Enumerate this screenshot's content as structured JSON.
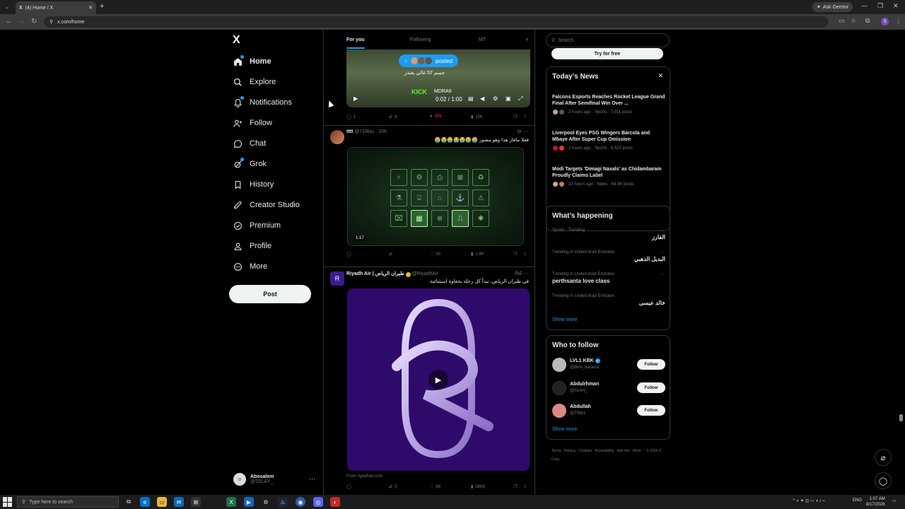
{
  "browser": {
    "tab_title": "(4) Home / X",
    "new_tab": "+",
    "ask_gemini": "Ask Gemini",
    "url": "x.com/home",
    "profile_initial": "S"
  },
  "nav": {
    "logo": "X",
    "items": [
      {
        "label": "Home"
      },
      {
        "label": "Explore"
      },
      {
        "label": "Notifications"
      },
      {
        "label": "Follow"
      },
      {
        "label": "Chat"
      },
      {
        "label": "Grok"
      },
      {
        "label": "History"
      },
      {
        "label": "Creator Studio"
      },
      {
        "label": "Premium"
      },
      {
        "label": "Profile"
      },
      {
        "label": "More"
      }
    ],
    "post_button": "Post",
    "account": {
      "name": "Abosalem",
      "handle": "@2SLAY_",
      "more": "···"
    }
  },
  "feed": {
    "tabs": [
      "For you",
      "Following",
      "MT"
    ],
    "add_tab": "+",
    "post1": {
      "posted_pill": "posted",
      "overlay_text": "ﺟﺴﻢ 57 ﻏﺎﻟﻲ ﻳﻌﺘﺬﺭ",
      "kick": "KICK",
      "streamer": "MDRA9",
      "time": "0:02 / 1:00",
      "replies": "1",
      "reposts": "9",
      "likes": "309",
      "views": "10K"
    },
    "post2": {
      "name": "tttt",
      "handle": "@71Illuu",
      "time": "· 20h",
      "text": "فعلا مافاز هذا وهو مصور 😭😭😭😭😭😭😭",
      "duration": "1:17",
      "replies": "",
      "reposts": "",
      "likes": "30",
      "views": "1.9K"
    },
    "post3": {
      "name": "Riyadh Air | طيران الرياض",
      "handle": "@RiyadhAir",
      "ad": "Ad",
      "text": "في طيران الرياض، تبدأ كل رحلة بحفاوة استثنائية.",
      "from": "From riyadhair.com",
      "reposts": "3",
      "likes": "86",
      "views": "380K"
    }
  },
  "sidebar": {
    "search_placeholder": "Search",
    "try_button": "Try for free",
    "news": {
      "title": "Today’s News",
      "close": "✕",
      "items": [
        {
          "title": "Falcons Esports Reaches Rocket League Grand Final After Semifinal Win Over ...",
          "meta": "3 hours ago · Sports · 7,911 posts"
        },
        {
          "title": "Liverpool Eyes PSG Wingers Barcola and Mbaye After Super Cup Omission",
          "meta": "2 hours ago · Sports · 8,523 posts"
        },
        {
          "title": "Modi Targets 'Dimagi Naxals' as Chidambaram Proudly Claims Label",
          "meta": "22 hours ago · News · 64.8K posts"
        }
      ]
    },
    "happening": {
      "title": "What’s happening",
      "trends": [
        {
          "context": "Sports · Trending",
          "name": "الفارز",
          "rtl": true
        },
        {
          "context": "Trending in United Arab Emirates",
          "name": "البديل الذهبي",
          "rtl": true
        },
        {
          "context": "Trending in United Arab Emirates",
          "name": "perthsanta love class",
          "rtl": false
        },
        {
          "context": "Trending in United Arab Emirates",
          "name": "خالد عيسى",
          "rtl": true
        }
      ],
      "show_more": "Show more"
    },
    "who_to_follow": {
      "title": "Who to follow",
      "users": [
        {
          "name": "LVL1 KBK",
          "handle": "@Blnn_karama",
          "button": "Follow"
        },
        {
          "name": "Abdulrhman",
          "handle": "@01AH_",
          "button": "Follow"
        },
        {
          "name": "Abdullah",
          "handle": "@T09zz",
          "button": "Follow"
        }
      ],
      "show_more": "Show more"
    },
    "footer": "Terms · Privacy · Cookies · Accessibility · Ads info · More ··· © 2026 X Corp."
  },
  "taskbar": {
    "search_placeholder": "Type here to search",
    "lang": "ENG",
    "time": "1:07 AM",
    "date": "8/17/2026"
  },
  "colors": {
    "accent": "#1d9bf0",
    "like": "#f91880",
    "background": "#000000",
    "ad_purple": "#2e0a6b"
  }
}
